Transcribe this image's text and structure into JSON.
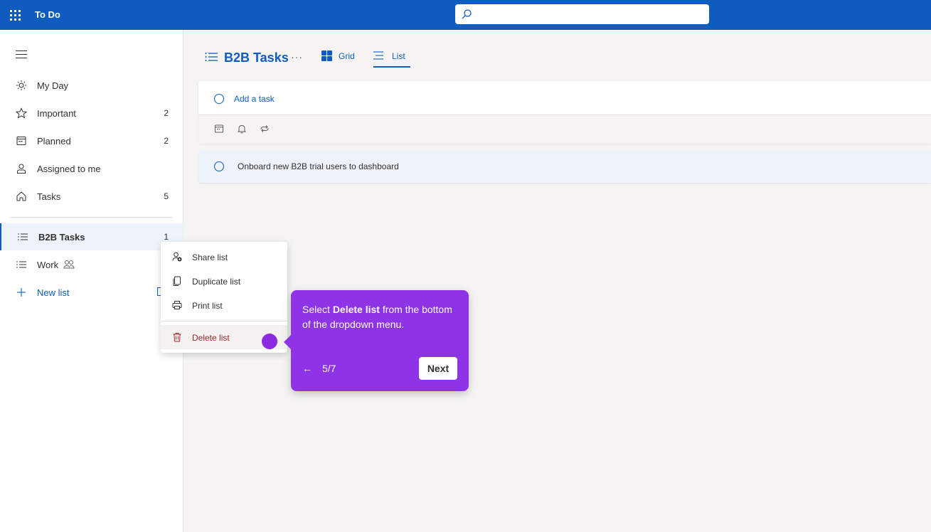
{
  "topbar": {
    "app_title": "To Do",
    "search_placeholder": "",
    "icons": [
      "waffle-icon",
      "search-icon"
    ]
  },
  "sidebar": {
    "items": [
      {
        "label": "My Day",
        "count": "",
        "icon": "sun-icon"
      },
      {
        "label": "Important",
        "count": "2",
        "icon": "star-icon"
      },
      {
        "label": "Planned",
        "count": "2",
        "icon": "calendar-icon"
      },
      {
        "label": "Assigned to me",
        "count": "",
        "icon": "person-icon"
      },
      {
        "label": "Tasks",
        "count": "5",
        "icon": "home-icon"
      }
    ],
    "lists": [
      {
        "label": "B2B Tasks",
        "count": "1",
        "icon": "list-icon",
        "active": true
      },
      {
        "label": "Work",
        "count": "",
        "icon": "list-icon",
        "shared": true
      }
    ],
    "new_list_label": "New list"
  },
  "main": {
    "list_title": "B2B Tasks",
    "more_label": "···",
    "views": {
      "grid": "Grid",
      "list": "List",
      "selected": "List"
    },
    "add_task_label": "Add a task",
    "tasks": [
      {
        "title": "Onboard new B2B trial users to dashboard"
      }
    ]
  },
  "context_menu": {
    "items": [
      {
        "label": "Share list",
        "icon": "share-person-icon"
      },
      {
        "label": "Duplicate list",
        "icon": "duplicate-icon"
      },
      {
        "label": "Print list",
        "icon": "printer-icon"
      },
      {
        "label": "Delete list",
        "icon": "trash-icon",
        "danger": true
      }
    ]
  },
  "tooltip": {
    "text_before": "Select ",
    "text_bold": "Delete list",
    "text_after": " from the bottom of the dropdown menu.",
    "back_label": "←",
    "step": "5/7",
    "next_label": "Next"
  },
  "colors": {
    "brand": "#0f5cc0",
    "tooltip": "#8f33e6",
    "danger": "#a4262c"
  }
}
